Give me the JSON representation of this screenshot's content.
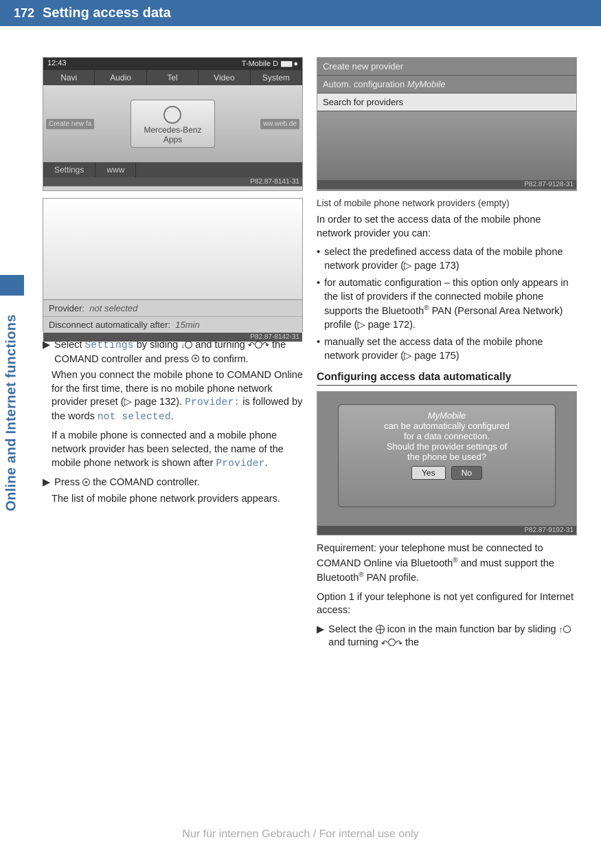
{
  "header": {
    "page_number": "172",
    "title": "Setting access data"
  },
  "side_tab": {
    "label": "Online and Internet functions"
  },
  "screenshot1": {
    "time": "12:43",
    "carrier": "T-Mobile D",
    "menu": {
      "navi": "Navi",
      "audio": "Audio",
      "tel": "Tel",
      "video": "Video",
      "system": "System"
    },
    "left_btn": "Create new fa",
    "right_btn": "ww.web.de",
    "center_line1": "Mercedes-Benz",
    "center_line2": "Apps",
    "footer": {
      "settings": "Settings",
      "www": "www"
    },
    "id": "P82.87-8141-31"
  },
  "screenshot2": {
    "row1_label": "Provider:",
    "row1_value": "not selected",
    "row2_label": "Disconnect automatically after:",
    "row2_value": "15min",
    "id": "P82.87-8142-31"
  },
  "screenshot3": {
    "row1": "Create new provider",
    "row2_a": "Autom. configuration",
    "row2_b": "MyMobile",
    "row3": "Search for providers",
    "id": "P82.87-9128-31"
  },
  "screenshot4": {
    "line1": "MyMobile",
    "line2": "can be automatically configured",
    "line3": "for a data connection.",
    "line4": "Should the provider settings of",
    "line5": "the phone be used?",
    "btn_yes": "Yes",
    "btn_no": "No",
    "id": "P82.87-9192-31"
  },
  "left_col": {
    "step1_a": "Select ",
    "step1_settings": "Settings",
    "step1_b": " by sliding ",
    "step1_c": " and turning ",
    "step1_d": " the COMAND controller and press ",
    "step1_e": " to confirm.",
    "cont1_a": "When you connect the mobile phone to COMAND Online for the first time, there is no mobile phone network provider preset (",
    "cont1_ref": "▷ page 132",
    "cont1_b": "). ",
    "cont1_provider": "Provider:",
    "cont1_c": " is followed by the words ",
    "cont1_notsel": "not selected",
    "cont1_d": ".",
    "cont2_a": "If a mobile phone is connected and a mobile phone network provider has been selected, the name of the mobile phone network is shown after ",
    "cont2_provider": "Provider",
    "cont2_b": ".",
    "step2_a": "Press ",
    "step2_b": " the COMAND controller.",
    "cont3": "The list of mobile phone network providers appears."
  },
  "right_col": {
    "caption3": "List of mobile phone network providers (empty)",
    "para1": "In order to set the access data of the mobile phone network provider you can:",
    "bullet1_a": "select the predefined access data of the mobile phone network provider (",
    "bullet1_ref": "▷ page 173",
    "bullet1_b": ")",
    "bullet2_a": "for automatic configuration – this option only appears in the list of providers if the connected mobile phone supports the Bluetooth",
    "bullet2_b": " PAN (Personal Area Network) profile (",
    "bullet2_ref": "▷ page 172",
    "bullet2_c": ").",
    "bullet3_a": "manually set the access data of the mobile phone network provider (",
    "bullet3_ref": "▷ page 175",
    "bullet3_b": ")",
    "section_head": "Configuring access data automatically",
    "para2_a": "Requirement: your telephone must be connected to COMAND Online via Bluetooth",
    "para2_b": " and must support the Bluetooth",
    "para2_c": " PAN profile.",
    "para3": "Option 1 if your telephone is not yet configured for Internet access:",
    "step_r1_a": "Select the ",
    "step_r1_b": " icon in the main function bar by sliding ",
    "step_r1_c": " and turning ",
    "step_r1_d": " the"
  },
  "footer": {
    "text": "Nur für internen Gebrauch / For internal use only"
  },
  "reg_mark": "®"
}
